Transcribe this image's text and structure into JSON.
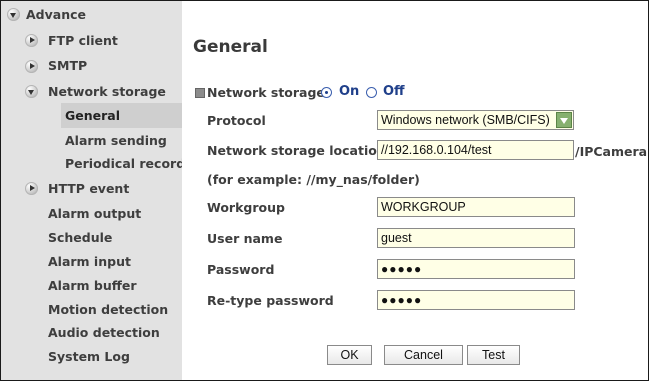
{
  "sidebar": {
    "advance": "Advance",
    "ftp_client": "FTP client",
    "smtp": "SMTP",
    "network_storage": "Network storage",
    "general": "General",
    "alarm_sending": "Alarm sending",
    "periodical_recording": "Periodical recordi",
    "http_event": "HTTP event",
    "alarm_output": "Alarm output",
    "schedule": "Schedule",
    "alarm_input": "Alarm input",
    "alarm_buffer": "Alarm buffer",
    "motion_detection": "Motion detection",
    "audio_detection": "Audio detection",
    "system_log": "System Log"
  },
  "main": {
    "title": "General",
    "network_storage_label": "Network storage",
    "on_label": "On",
    "off_label": "Off",
    "network_storage_state": "On",
    "protocol_label": "Protocol",
    "protocol_value": "Windows network (SMB/CIFS)",
    "location_label": "Network storage location",
    "location_value": "//192.168.0.104/test",
    "location_suffix": "/IPCamera",
    "example_text": "(for example: //my_nas/folder)",
    "workgroup_label": "Workgroup",
    "workgroup_value": "WORKGROUP",
    "username_label": "User name",
    "username_value": "guest",
    "password_label": "Password",
    "password_value": "●●●●●",
    "retype_label": "Re-type password",
    "retype_value": "●●●●●",
    "ok_label": "OK",
    "cancel_label": "Cancel",
    "test_label": "Test"
  },
  "colors": {
    "sidebar_bg": "#e2e2e2",
    "selected_bg": "#cfcfcf",
    "input_bg": "#ffffe6",
    "radio_blue": "#1f3f8a",
    "select_green": "#86b06f"
  }
}
